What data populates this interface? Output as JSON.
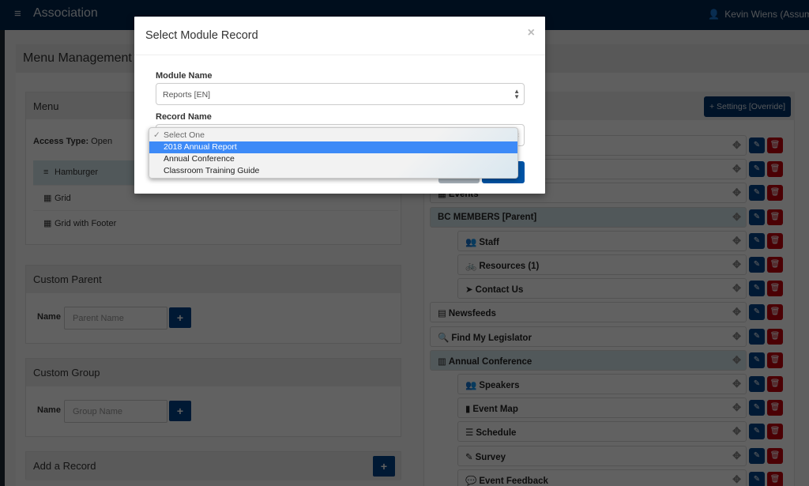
{
  "navbar": {
    "menu_icon": "hamburger-icon",
    "brand": "Association",
    "user_icon": "user-icon",
    "user_name": "Kevin Wiens (Assum"
  },
  "page": {
    "title": "Menu Management"
  },
  "menu_panel": {
    "title": "Menu",
    "access_label": "Access Type:",
    "access_value": "Open",
    "options": [
      {
        "icon": "bars-icon",
        "glyph": "≡",
        "label": "Hamburger",
        "active": true
      },
      {
        "icon": "grid-icon",
        "glyph": "▦",
        "label": "Grid",
        "active": false
      },
      {
        "icon": "grid-icon",
        "glyph": "▦",
        "label": "Grid with Footer",
        "active": false
      }
    ]
  },
  "custom_parent": {
    "title": "Custom Parent",
    "name_label": "Name",
    "placeholder": "Parent Name",
    "add_label": "+"
  },
  "custom_group": {
    "title": "Custom Group",
    "name_label": "Name",
    "placeholder": "Group Name",
    "add_label": "+"
  },
  "add_record": {
    "title": "Add a Record",
    "add_label": "+"
  },
  "right_panel": {
    "settings_button": "+ Settings [Override]",
    "items": [
      {
        "label": "",
        "icon": "",
        "glyph": "",
        "level": "top",
        "parent": false
      },
      {
        "label": "",
        "icon": "",
        "glyph": "",
        "level": "top",
        "parent": false
      },
      {
        "label": "Events",
        "icon": "calendar-icon",
        "glyph": "▦",
        "level": "top",
        "parent": false
      },
      {
        "label": "BC MEMBERS [Parent]",
        "icon": "",
        "glyph": "",
        "level": "top",
        "parent": true
      },
      {
        "label": "Staff",
        "icon": "users-icon",
        "glyph": "👥",
        "level": "child",
        "parent": false
      },
      {
        "label": "Resources (1)",
        "icon": "bicycle-icon",
        "glyph": "🚲",
        "level": "child",
        "parent": false
      },
      {
        "label": "Contact Us",
        "icon": "paper-plane-icon",
        "glyph": "➤",
        "level": "child",
        "parent": false
      },
      {
        "label": "Newsfeeds",
        "icon": "newspaper-icon",
        "glyph": "▤",
        "level": "top",
        "parent": false
      },
      {
        "label": "Find My Legislator",
        "icon": "search-icon",
        "glyph": "🔍",
        "level": "top",
        "parent": false
      },
      {
        "label": "Annual Conference",
        "icon": "building-icon",
        "glyph": "▥",
        "level": "top",
        "parent": true
      },
      {
        "label": "Speakers",
        "icon": "users-icon",
        "glyph": "👥",
        "level": "child",
        "parent": false
      },
      {
        "label": "Event Map",
        "icon": "map-icon",
        "glyph": "▮",
        "level": "child",
        "parent": false
      },
      {
        "label": "Schedule",
        "icon": "list-ol-icon",
        "glyph": "☰",
        "level": "child",
        "parent": false
      },
      {
        "label": "Survey",
        "icon": "edit-icon",
        "glyph": "✎",
        "level": "child",
        "parent": false
      },
      {
        "label": "Event Feedback",
        "icon": "comment-icon",
        "glyph": "💬",
        "level": "child",
        "parent": false
      }
    ],
    "move_glyph": "✥",
    "edit_glyph": "✎",
    "delete_glyph": "🗑"
  },
  "modal": {
    "title": "Select Module Record",
    "close": "×",
    "module_label": "Module Name",
    "module_value": "Reports [EN]",
    "record_label": "Record Name",
    "record_options": [
      {
        "label": "Select One",
        "state": "checked-placeholder"
      },
      {
        "label": "2018 Annual Report",
        "state": "highlighted"
      },
      {
        "label": "Annual Conference",
        "state": "normal"
      },
      {
        "label": "Classroom Training Guide",
        "state": "normal"
      }
    ],
    "check_glyph": "✓"
  },
  "colors": {
    "navbar": "#00264d",
    "primary": "#00428a",
    "danger": "#c4000c",
    "highlight": "#3d8af7",
    "parent_row": "#d6e6ec"
  }
}
